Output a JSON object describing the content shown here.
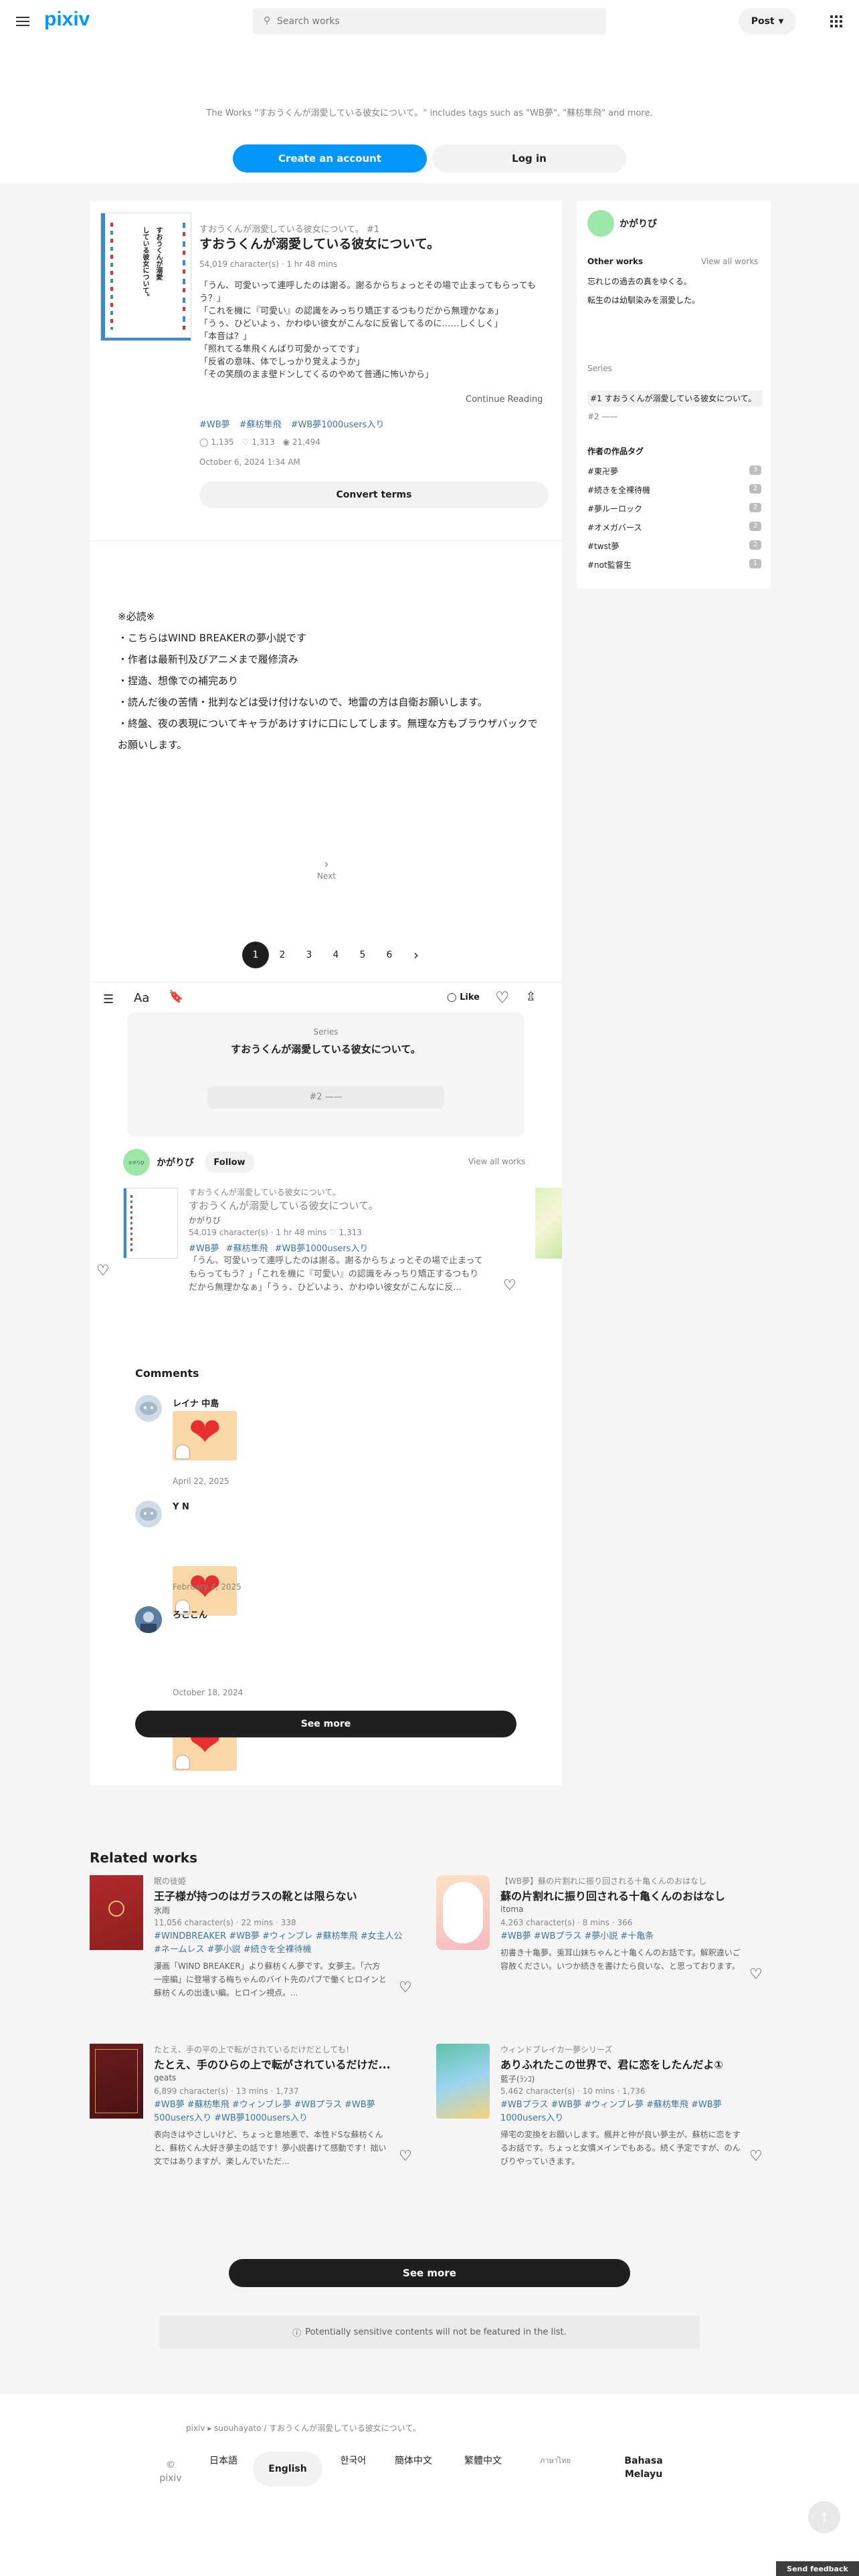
{
  "header": {
    "logo": "pixiv",
    "search_placeholder": "Search works",
    "post_label": "Post"
  },
  "hero": {
    "description": "The Works \"すおうくんが溺愛している彼女について。\" includes tags such as \"WB夢\", \"蘇枋隼飛\" and more.",
    "create_account": "Create an account",
    "login": "Log in"
  },
  "novel": {
    "series_label": "すおうくんが溺愛している彼女について。 #1",
    "title": "すおうくんが溺愛している彼女について。",
    "meta": "54,019 character(s) · 1 hr 48 mins",
    "excerpt": [
      "「うん、可愛いって連呼したのは謝る。謝るからちょっとその場で止まってもらってもう？」",
      "「これを機に『可愛い』の認識をみっちり矯正するつもりだから無理かなぁ」",
      "「うぅ、ひどいよぅ、かわゆい彼女がこんなに反省してるのに……しくしく」",
      "「本音は？」",
      "「照れてる隼飛くんばり可愛かってです」",
      "「反省の意味、体でしっかり覚えようか」",
      "「その笑顔のまま壁ドンしてくるのやめて普通に怖いから」"
    ],
    "continue": "Continue Reading",
    "tags": [
      "#WB夢",
      "#蘇枋隼飛",
      "#WB夢1000users入り"
    ],
    "likes": "1,135",
    "bookmarks": "1,313",
    "views": "21,494",
    "date": "October 6, 2024 1:34 AM",
    "convert": "Convert terms",
    "cover_text": [
      "すおうくんが溺愛",
      "している彼女について。"
    ]
  },
  "body": {
    "lines": [
      "※必読※",
      "・こちらはWIND BREAKERの夢小説です",
      "・作者は最新刊及びアニメまで履修済み",
      "・捏造、想像での補完あり",
      "・読んだ後の苦情・批判などは受け付けないので、地雷の方は自衛お願いします。",
      "・終盤、夜の表現についてキャラがあけすけに口にしてします。無理な方もブラウザバックでお願いします。"
    ],
    "next": "Next"
  },
  "pagination": [
    "1",
    "2",
    "3",
    "4",
    "5",
    "6"
  ],
  "toolbar": {
    "like": "Like"
  },
  "series_box": {
    "label": "Series",
    "title": "すおうくんが溺愛している彼女について。",
    "next": "#2 ——"
  },
  "author": {
    "name": "かがりび",
    "follow": "Follow",
    "view_all": "View all works",
    "avatar_text": "かがりび"
  },
  "author_work": {
    "series": "すおうくんが溺愛している彼女について。",
    "title": "すおうくんが溺愛している彼女について。",
    "author": "かがりび",
    "meta": "54,019 character(s) · 1 hr 48 mins",
    "likes": "1,313",
    "tags": [
      "#WB夢",
      "#蘇枋隼飛",
      "#WB夢1000users入り"
    ],
    "desc": "「うん、可愛いって連呼したのは謝る。謝るからちょっとその場で止まってもらってもう？」「これを機に『可愛い』の認識をみっちり矯正するつもりだから無理かなぁ」「うぅ、ひどいよぅ、かわゆい彼女がこんなに反..."
  },
  "comments": {
    "heading": "Comments",
    "items": [
      {
        "name": "レイナ 中島",
        "date": "April 22, 2025"
      },
      {
        "name": "Y N",
        "date": "February 4, 2025"
      },
      {
        "name": "ろここん",
        "date": "October 18, 2024"
      }
    ],
    "see_more": "See more"
  },
  "sidebar": {
    "author": "かがりび",
    "other_works": "Other works",
    "view_all": "View all works",
    "works": [
      "忘れじの過去の真をゆくる。",
      "転生のは幼馴染みを溺愛した。"
    ],
    "series_label": "Series",
    "series_current": "#1 すおうくんが溺愛している彼女について。",
    "series_next": "#2 ——",
    "tags_heading": "作者の作品タグ",
    "tags": [
      {
        "name": "#東卍夢",
        "count": "3"
      },
      {
        "name": "#続きを全裸待機",
        "count": "2"
      },
      {
        "name": "#夢ルーロック",
        "count": "2"
      },
      {
        "name": "#オメガバース",
        "count": "2"
      },
      {
        "name": "#twst夢",
        "count": "2"
      },
      {
        "name": "#not監督生",
        "count": "1"
      }
    ]
  },
  "related": {
    "heading": "Related works",
    "items": [
      {
        "series": "眠の徒姫",
        "title": "王子様が持つのはガラスの靴とは限らない",
        "author": "氷雨",
        "meta": "11,056 character(s) · 22 mins · 338",
        "tags": "#WINDBREAKER #WB夢 #ウィンブレ #蘇枋隼飛 #女主人公 #ネームレス #夢小説 #続きを全裸待機",
        "desc": "漫画「WIND BREAKER」より蘇枋くん夢です。女夢主。「六方一座編」に登場する梅ちゃんのバイト先のパブで働くヒロインと蘇枋くんの出逢い編。ヒロイン視点。...",
        "cover": "#b02a2a",
        "cover2": "#8d1f1f"
      },
      {
        "series": "【WB夢】蘇の片割れに振り回される十亀くんのおはなし",
        "title": "蘇の片割れに振り回される十亀くんのおはなし",
        "author": "itoma",
        "meta": "4,263 character(s) · 8 mins · 366",
        "tags": "#WB夢 #WBプラス #夢小説 #十亀条",
        "desc": "初書き十亀夢。兎耳山妹ちゃんと十亀くんのお話です。解釈違いご容赦ください。いつか続きを書けたら良いな、と思っております。",
        "cover": "#fbe2c3",
        "cover2": "#f6b9c2"
      },
      {
        "series": "たとえ、手の平の上で転がされているだけだとしても！",
        "title": "たとえ、手のひらの上で転がされているだけだ...",
        "author": "geats",
        "meta": "6,899 character(s) · 13 mins · 1,737",
        "tags": "#WB夢 #蘇枋隼飛 #ウィンブレ夢 #WBプラス #WB夢500users入り #WB夢1000users入り",
        "desc": "表向きはやさしいけど、ちょっと意地悪で、本性ドSな蘇枋くんと、蘇枋くん大好き夢主の話です！夢小説書けて感動です！拙い文ではありますが、楽しんでいただ...",
        "cover": "#6b1c1c",
        "cover2": "#4a1212"
      },
      {
        "series": "ウィンドブレイカー夢シリーズ",
        "title": "ありふれたこの世界で、君に恋をしたんだよ①",
        "author": "藍子(ﾗﾝｺ)",
        "meta": "5,462 character(s) · 10 mins · 1,736",
        "tags": "#WBプラス #WB夢 #ウィンブレ夢 #蘇枋隼飛 #WB夢1000users入り",
        "desc": "帰宅の変換をお願いします。楓井と仲が良い夢主が、蘇枋に恋をするお話です。ちょっと女慣メインでもある。続く予定ですが、のんびりやっていきます。",
        "cover": "#5fc1a7",
        "cover2": "#9ad4f0"
      }
    ],
    "see_more": "See more",
    "notice": "Potentially sensitive contents will not be featured in the list."
  },
  "footer": {
    "breadcrumb_root": "pixiv",
    "breadcrumb_user": "suouhayato",
    "breadcrumb_page": "すおうくんが溺愛している彼女について。",
    "copyright": "© pixiv",
    "langs": [
      "日本語",
      "English",
      "한국어",
      "簡体中文",
      "繁體中文",
      "ภาษาไทย",
      "Bahasa Melayu"
    ],
    "feedback": "Send feedback"
  }
}
